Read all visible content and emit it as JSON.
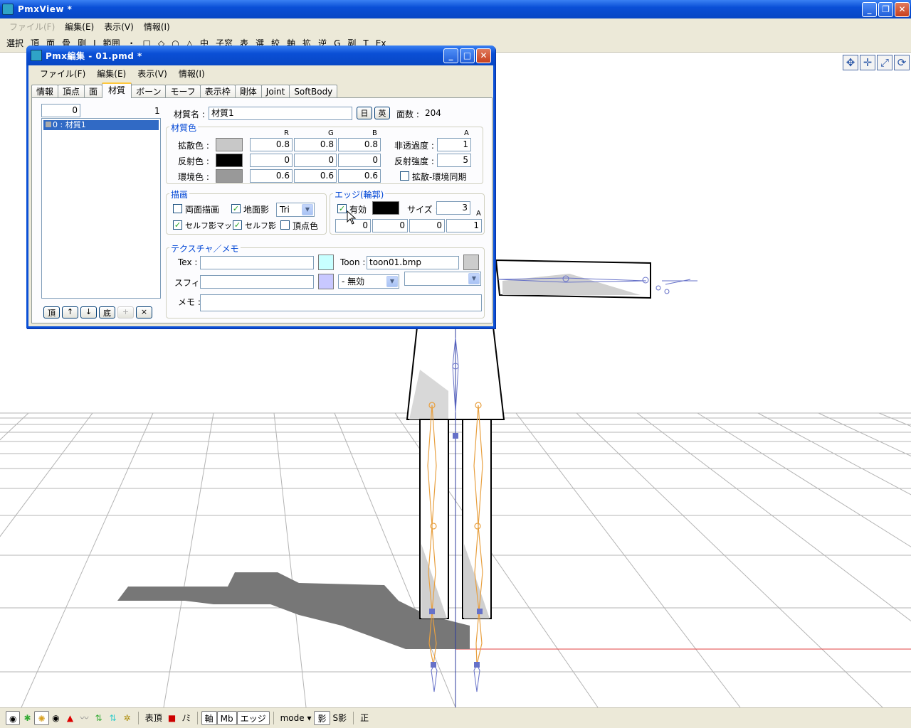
{
  "app": {
    "title": "PmxView *"
  },
  "main_menu": [
    "ファイル(F)",
    "編集(E)",
    "表示(V)",
    "情報(I)"
  ],
  "toolbar": {
    "items": [
      "選択",
      "頂",
      "面",
      "骨",
      "剛",
      "J",
      "範囲",
      "・",
      "□",
      "◇",
      "○",
      "△",
      "中",
      "子窓",
      "表",
      "選",
      "絞",
      "軸",
      "拡",
      "逆",
      "G",
      "副",
      "T",
      "Ex"
    ]
  },
  "status_bar": {
    "items": [
      "表頂",
      "ﾉﾐ",
      "軸",
      "Mb",
      "エッジ",
      "mode ▾",
      "影",
      "S影",
      "正"
    ]
  },
  "dialog": {
    "title": "Pmx編集 - 01.pmd *",
    "menu": [
      "ファイル(F)",
      "編集(E)",
      "表示(V)",
      "情報(I)"
    ],
    "tabs": [
      "情報",
      "頂点",
      "面",
      "材質",
      "ボーン",
      "モーフ",
      "表示枠",
      "剛体",
      "Joint",
      "SoftBody"
    ],
    "active_tab": "材質",
    "index_input": "0",
    "count": "1",
    "list_items": [
      "0 : 材質1"
    ],
    "list_buttons": [
      "頂",
      "↑",
      "↓",
      "底",
      "+",
      "×"
    ],
    "material": {
      "name_label": "材質名 :",
      "name_value": "材質1",
      "btn_jp": "日",
      "btn_en": "英",
      "face_count_label": "面数 :",
      "face_count": "204",
      "color_group_title": "材質色",
      "col_r": "R",
      "col_g": "G",
      "col_b": "B",
      "col_a": "A",
      "diffuse_label": "拡散色 :",
      "diffuse": [
        "0.8",
        "0.8",
        "0.8"
      ],
      "diffuse_swatch": "#c8c8c8",
      "specular_label": "反射色 :",
      "specular": [
        "0",
        "0",
        "0"
      ],
      "specular_swatch": "#000000",
      "ambient_label": "環境色 :",
      "ambient": [
        "0.6",
        "0.6",
        "0.6"
      ],
      "ambient_swatch": "#999999",
      "opacity_label": "非透過度 :",
      "opacity": "1",
      "spec_power_label": "反射強度 :",
      "spec_power": "5",
      "sync_label": "拡散-環境同期",
      "draw_group_title": "描画",
      "double_sided_label": "両面描画",
      "ground_shadow_label": "地面影",
      "shadow_mode": "Tri",
      "self_shadow_map_label": "セルフ影マップ",
      "self_shadow_label": "セルフ影",
      "vertex_color_label": "頂点色",
      "edge_group_title": "エッジ(輪郭)",
      "edge_enabled_label": "有効",
      "edge_size_label": "サイズ :",
      "edge_size": "3",
      "edge_color": [
        "0",
        "0",
        "0",
        "1"
      ],
      "edge_swatch": "#000000",
      "texture_group_title": "テクスチャ／メモ",
      "tex_label": "Tex :",
      "tex_value": "",
      "tex_swatch": "#c8ffff",
      "toon_label": "Toon :",
      "toon_value": "toon01.bmp",
      "toon_swatch": "#cccccc",
      "sphere_label": "スフィア :",
      "sphere_value": "",
      "sphere_swatch": "#c8c8ff",
      "sphere_mode": "- 無効",
      "memo_label": "メモ :",
      "memo_value": ""
    }
  }
}
